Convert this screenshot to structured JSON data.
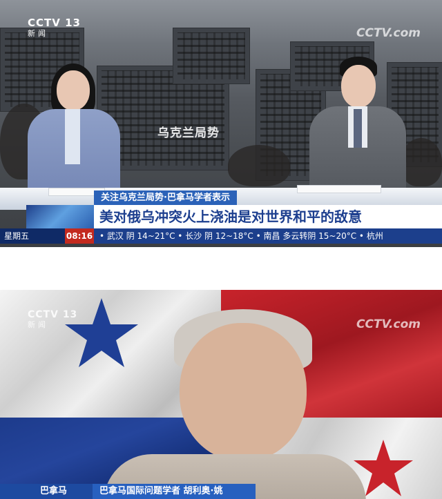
{
  "frame1": {
    "channel_logo": {
      "brand": "CCTV",
      "number": "13",
      "sub": "新闻"
    },
    "watermark": "CCTV.com",
    "topic_overlay": "乌克兰局势",
    "lower_third": {
      "kicker": "关注乌克兰局势·巴拿马学者表示",
      "headline": "美对俄乌冲突火上浇油是对世界和平的敌意"
    },
    "ticker": {
      "day": "星期五",
      "time": "08:16",
      "text": "• 武汉 阴 14~21°C • 长沙 阴 12~18°C • 南昌 多云转阴 15~20°C • 杭州"
    }
  },
  "frame2": {
    "channel_logo": {
      "brand": "CCTV",
      "number": "13",
      "sub": "新闻"
    },
    "watermark": "CCTV.com",
    "lower_third": {
      "location": "巴拿马",
      "name": "巴拿马国际问题学者 胡利奥·姚"
    }
  },
  "colors": {
    "cctv_blue": "#1c3f8c",
    "headline_text": "#1d3f8f",
    "time_red": "#c32a1f",
    "flag_red": "#c8232b",
    "flag_blue": "#1d3b8c"
  }
}
